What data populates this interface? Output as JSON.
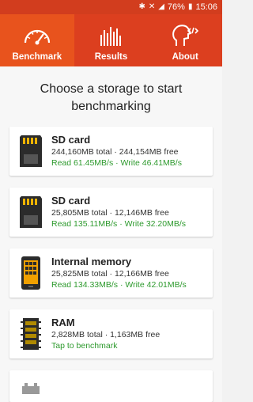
{
  "status": {
    "battery": "76%",
    "time": "15:06"
  },
  "tabs": [
    {
      "label": "Benchmark",
      "icon": "speedometer-icon"
    },
    {
      "label": "Results",
      "icon": "bar-chart-icon"
    },
    {
      "label": "About",
      "icon": "head-code-icon"
    }
  ],
  "heading": "Choose a storage to start benchmarking",
  "storages": [
    {
      "title": "SD card",
      "info": "244,160MB total · 244,154MB free",
      "speed": "Read 61.45MB/s · Write 46.41MB/s",
      "icon": "sd-card-icon"
    },
    {
      "title": "SD card",
      "info": "25,805MB total · 12,146MB free",
      "speed": "Read 135.11MB/s · Write 32.20MB/s",
      "icon": "sd-card-icon"
    },
    {
      "title": "Internal memory",
      "info": "25,825MB total · 12,166MB free",
      "speed": "Read 134.33MB/s · Write 42.01MB/s",
      "icon": "phone-memory-icon"
    },
    {
      "title": "RAM",
      "info": "2,828MB total · 1,163MB free",
      "speed": "Tap to benchmark",
      "icon": "ram-chip-icon"
    }
  ],
  "colors": {
    "accent": "#dc3f1f",
    "active_tab": "#e8531d",
    "speed": "#2e9a2e"
  }
}
